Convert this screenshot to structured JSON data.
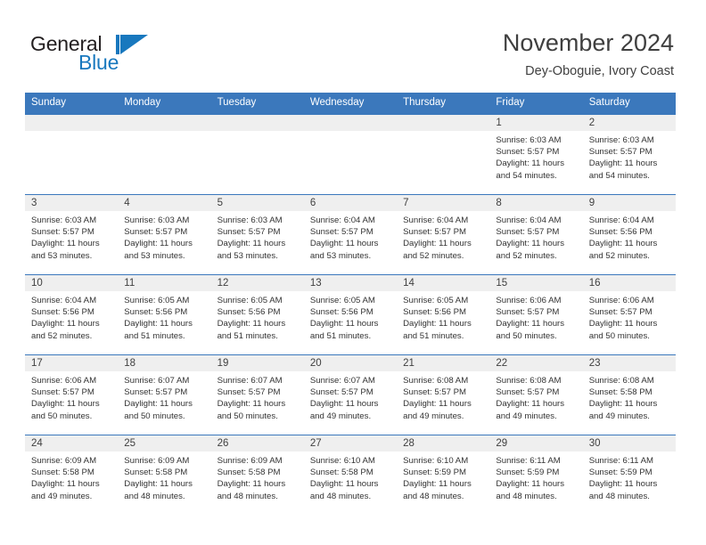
{
  "brand": {
    "name_part1": "General",
    "name_part2": "Blue",
    "accent_color": "#1878be",
    "logo_icon": "triangle-flag-icon"
  },
  "header": {
    "month_title": "November 2024",
    "location": "Dey-Oboguie, Ivory Coast"
  },
  "calendar": {
    "header_bg": "#3b78bc",
    "band_bg": "#efefef",
    "weekday_headers": [
      "Sunday",
      "Monday",
      "Tuesday",
      "Wednesday",
      "Thursday",
      "Friday",
      "Saturday"
    ],
    "weeks": [
      [
        {
          "day": "",
          "sunrise": "",
          "sunset": "",
          "daylight_l1": "",
          "daylight_l2": ""
        },
        {
          "day": "",
          "sunrise": "",
          "sunset": "",
          "daylight_l1": "",
          "daylight_l2": ""
        },
        {
          "day": "",
          "sunrise": "",
          "sunset": "",
          "daylight_l1": "",
          "daylight_l2": ""
        },
        {
          "day": "",
          "sunrise": "",
          "sunset": "",
          "daylight_l1": "",
          "daylight_l2": ""
        },
        {
          "day": "",
          "sunrise": "",
          "sunset": "",
          "daylight_l1": "",
          "daylight_l2": ""
        },
        {
          "day": "1",
          "sunrise": "Sunrise: 6:03 AM",
          "sunset": "Sunset: 5:57 PM",
          "daylight_l1": "Daylight: 11 hours",
          "daylight_l2": "and 54 minutes."
        },
        {
          "day": "2",
          "sunrise": "Sunrise: 6:03 AM",
          "sunset": "Sunset: 5:57 PM",
          "daylight_l1": "Daylight: 11 hours",
          "daylight_l2": "and 54 minutes."
        }
      ],
      [
        {
          "day": "3",
          "sunrise": "Sunrise: 6:03 AM",
          "sunset": "Sunset: 5:57 PM",
          "daylight_l1": "Daylight: 11 hours",
          "daylight_l2": "and 53 minutes."
        },
        {
          "day": "4",
          "sunrise": "Sunrise: 6:03 AM",
          "sunset": "Sunset: 5:57 PM",
          "daylight_l1": "Daylight: 11 hours",
          "daylight_l2": "and 53 minutes."
        },
        {
          "day": "5",
          "sunrise": "Sunrise: 6:03 AM",
          "sunset": "Sunset: 5:57 PM",
          "daylight_l1": "Daylight: 11 hours",
          "daylight_l2": "and 53 minutes."
        },
        {
          "day": "6",
          "sunrise": "Sunrise: 6:04 AM",
          "sunset": "Sunset: 5:57 PM",
          "daylight_l1": "Daylight: 11 hours",
          "daylight_l2": "and 53 minutes."
        },
        {
          "day": "7",
          "sunrise": "Sunrise: 6:04 AM",
          "sunset": "Sunset: 5:57 PM",
          "daylight_l1": "Daylight: 11 hours",
          "daylight_l2": "and 52 minutes."
        },
        {
          "day": "8",
          "sunrise": "Sunrise: 6:04 AM",
          "sunset": "Sunset: 5:57 PM",
          "daylight_l1": "Daylight: 11 hours",
          "daylight_l2": "and 52 minutes."
        },
        {
          "day": "9",
          "sunrise": "Sunrise: 6:04 AM",
          "sunset": "Sunset: 5:56 PM",
          "daylight_l1": "Daylight: 11 hours",
          "daylight_l2": "and 52 minutes."
        }
      ],
      [
        {
          "day": "10",
          "sunrise": "Sunrise: 6:04 AM",
          "sunset": "Sunset: 5:56 PM",
          "daylight_l1": "Daylight: 11 hours",
          "daylight_l2": "and 52 minutes."
        },
        {
          "day": "11",
          "sunrise": "Sunrise: 6:05 AM",
          "sunset": "Sunset: 5:56 PM",
          "daylight_l1": "Daylight: 11 hours",
          "daylight_l2": "and 51 minutes."
        },
        {
          "day": "12",
          "sunrise": "Sunrise: 6:05 AM",
          "sunset": "Sunset: 5:56 PM",
          "daylight_l1": "Daylight: 11 hours",
          "daylight_l2": "and 51 minutes."
        },
        {
          "day": "13",
          "sunrise": "Sunrise: 6:05 AM",
          "sunset": "Sunset: 5:56 PM",
          "daylight_l1": "Daylight: 11 hours",
          "daylight_l2": "and 51 minutes."
        },
        {
          "day": "14",
          "sunrise": "Sunrise: 6:05 AM",
          "sunset": "Sunset: 5:56 PM",
          "daylight_l1": "Daylight: 11 hours",
          "daylight_l2": "and 51 minutes."
        },
        {
          "day": "15",
          "sunrise": "Sunrise: 6:06 AM",
          "sunset": "Sunset: 5:57 PM",
          "daylight_l1": "Daylight: 11 hours",
          "daylight_l2": "and 50 minutes."
        },
        {
          "day": "16",
          "sunrise": "Sunrise: 6:06 AM",
          "sunset": "Sunset: 5:57 PM",
          "daylight_l1": "Daylight: 11 hours",
          "daylight_l2": "and 50 minutes."
        }
      ],
      [
        {
          "day": "17",
          "sunrise": "Sunrise: 6:06 AM",
          "sunset": "Sunset: 5:57 PM",
          "daylight_l1": "Daylight: 11 hours",
          "daylight_l2": "and 50 minutes."
        },
        {
          "day": "18",
          "sunrise": "Sunrise: 6:07 AM",
          "sunset": "Sunset: 5:57 PM",
          "daylight_l1": "Daylight: 11 hours",
          "daylight_l2": "and 50 minutes."
        },
        {
          "day": "19",
          "sunrise": "Sunrise: 6:07 AM",
          "sunset": "Sunset: 5:57 PM",
          "daylight_l1": "Daylight: 11 hours",
          "daylight_l2": "and 50 minutes."
        },
        {
          "day": "20",
          "sunrise": "Sunrise: 6:07 AM",
          "sunset": "Sunset: 5:57 PM",
          "daylight_l1": "Daylight: 11 hours",
          "daylight_l2": "and 49 minutes."
        },
        {
          "day": "21",
          "sunrise": "Sunrise: 6:08 AM",
          "sunset": "Sunset: 5:57 PM",
          "daylight_l1": "Daylight: 11 hours",
          "daylight_l2": "and 49 minutes."
        },
        {
          "day": "22",
          "sunrise": "Sunrise: 6:08 AM",
          "sunset": "Sunset: 5:57 PM",
          "daylight_l1": "Daylight: 11 hours",
          "daylight_l2": "and 49 minutes."
        },
        {
          "day": "23",
          "sunrise": "Sunrise: 6:08 AM",
          "sunset": "Sunset: 5:58 PM",
          "daylight_l1": "Daylight: 11 hours",
          "daylight_l2": "and 49 minutes."
        }
      ],
      [
        {
          "day": "24",
          "sunrise": "Sunrise: 6:09 AM",
          "sunset": "Sunset: 5:58 PM",
          "daylight_l1": "Daylight: 11 hours",
          "daylight_l2": "and 49 minutes."
        },
        {
          "day": "25",
          "sunrise": "Sunrise: 6:09 AM",
          "sunset": "Sunset: 5:58 PM",
          "daylight_l1": "Daylight: 11 hours",
          "daylight_l2": "and 48 minutes."
        },
        {
          "day": "26",
          "sunrise": "Sunrise: 6:09 AM",
          "sunset": "Sunset: 5:58 PM",
          "daylight_l1": "Daylight: 11 hours",
          "daylight_l2": "and 48 minutes."
        },
        {
          "day": "27",
          "sunrise": "Sunrise: 6:10 AM",
          "sunset": "Sunset: 5:58 PM",
          "daylight_l1": "Daylight: 11 hours",
          "daylight_l2": "and 48 minutes."
        },
        {
          "day": "28",
          "sunrise": "Sunrise: 6:10 AM",
          "sunset": "Sunset: 5:59 PM",
          "daylight_l1": "Daylight: 11 hours",
          "daylight_l2": "and 48 minutes."
        },
        {
          "day": "29",
          "sunrise": "Sunrise: 6:11 AM",
          "sunset": "Sunset: 5:59 PM",
          "daylight_l1": "Daylight: 11 hours",
          "daylight_l2": "and 48 minutes."
        },
        {
          "day": "30",
          "sunrise": "Sunrise: 6:11 AM",
          "sunset": "Sunset: 5:59 PM",
          "daylight_l1": "Daylight: 11 hours",
          "daylight_l2": "and 48 minutes."
        }
      ]
    ]
  }
}
